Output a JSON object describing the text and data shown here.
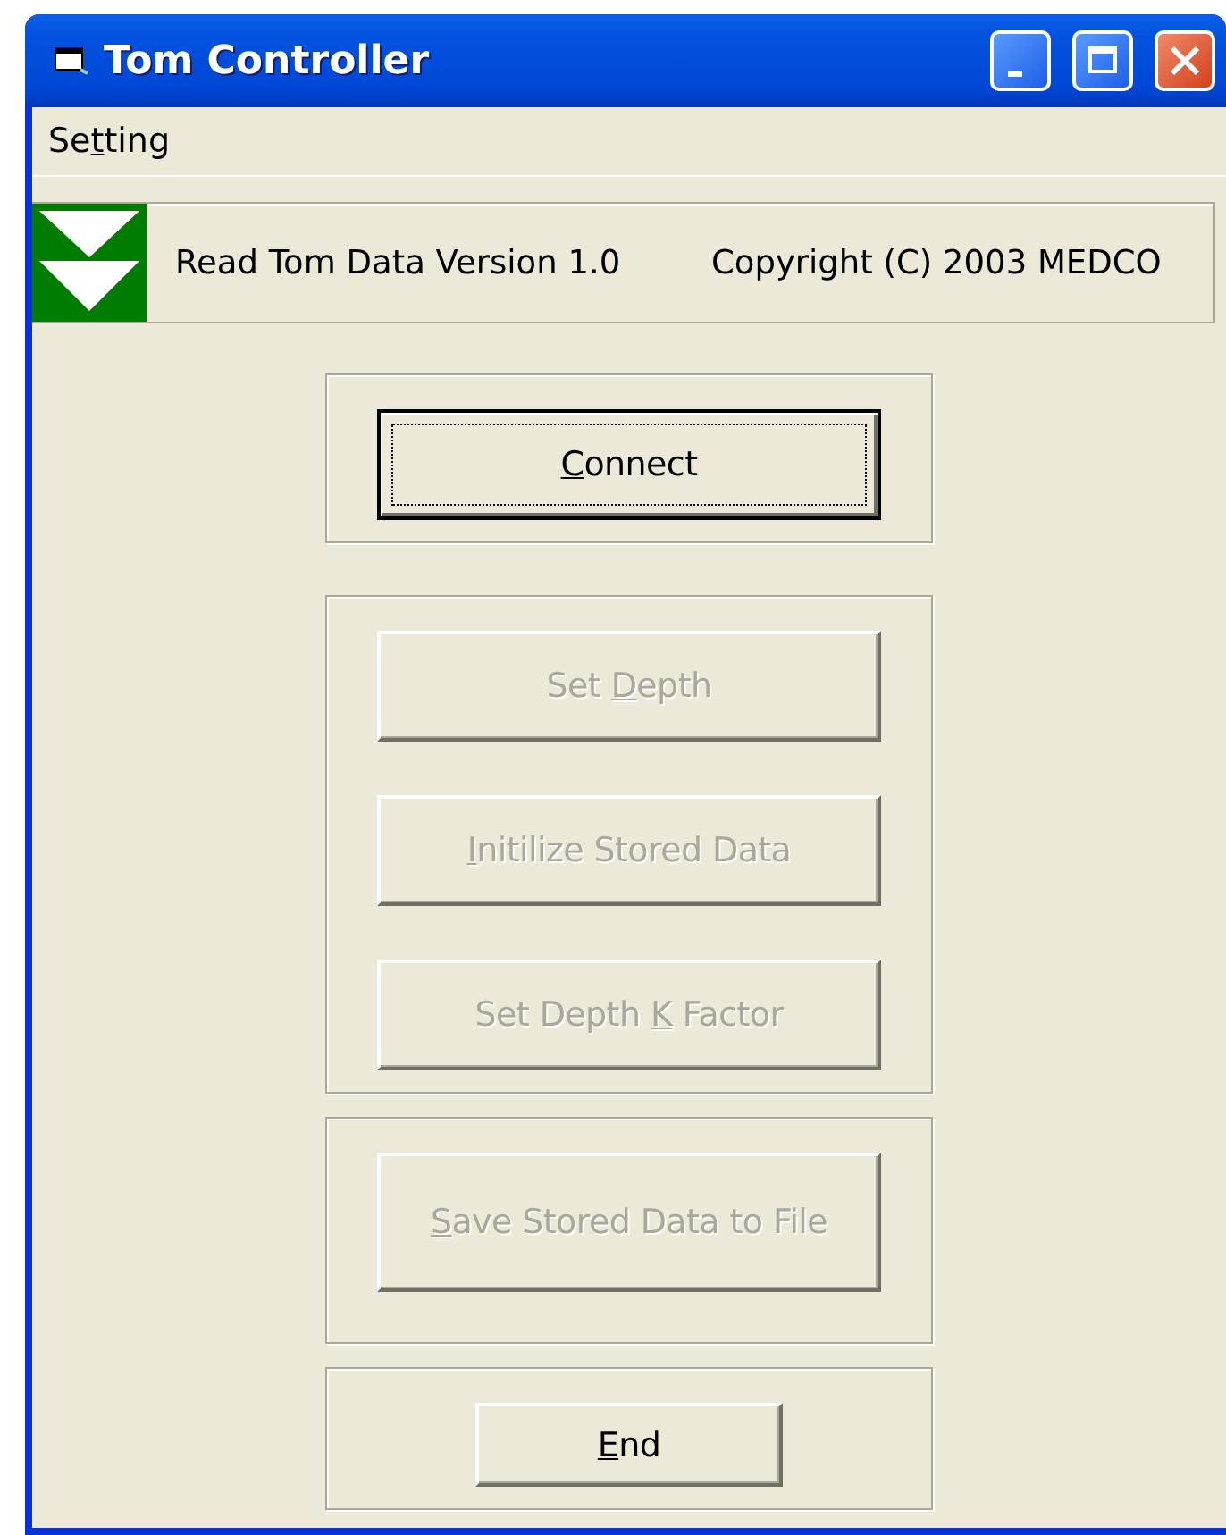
{
  "window": {
    "title": "Tom Controller"
  },
  "menu": [
    {
      "label_pre": "Se",
      "access_key": "t",
      "label_post": "ting"
    }
  ],
  "banner": {
    "product": "Read Tom Data Version 1.0",
    "copyright": "Copyright (C) 2003 MEDCO"
  },
  "groups": [
    {
      "buttons": [
        {
          "access_key": "C",
          "label_post": "onnect",
          "disabled": false,
          "focused": true
        }
      ]
    },
    {
      "buttons": [
        {
          "label_pre": "Set ",
          "access_key": "D",
          "label_post": "epth",
          "disabled": true,
          "focused": false
        },
        {
          "access_key": "I",
          "label_post": "nitilize Stored Data",
          "disabled": true,
          "focused": false
        },
        {
          "label_pre": "Set Depth ",
          "access_key": "K",
          "label_post": " Factor",
          "disabled": true,
          "focused": false
        }
      ]
    },
    {
      "buttons": [
        {
          "access_key": "S",
          "label_post": "ave Stored Data to File",
          "disabled": true,
          "focused": false
        }
      ]
    },
    {
      "buttons": [
        {
          "access_key": "E",
          "label_post": "nd",
          "disabled": false,
          "focused": false
        }
      ]
    }
  ]
}
